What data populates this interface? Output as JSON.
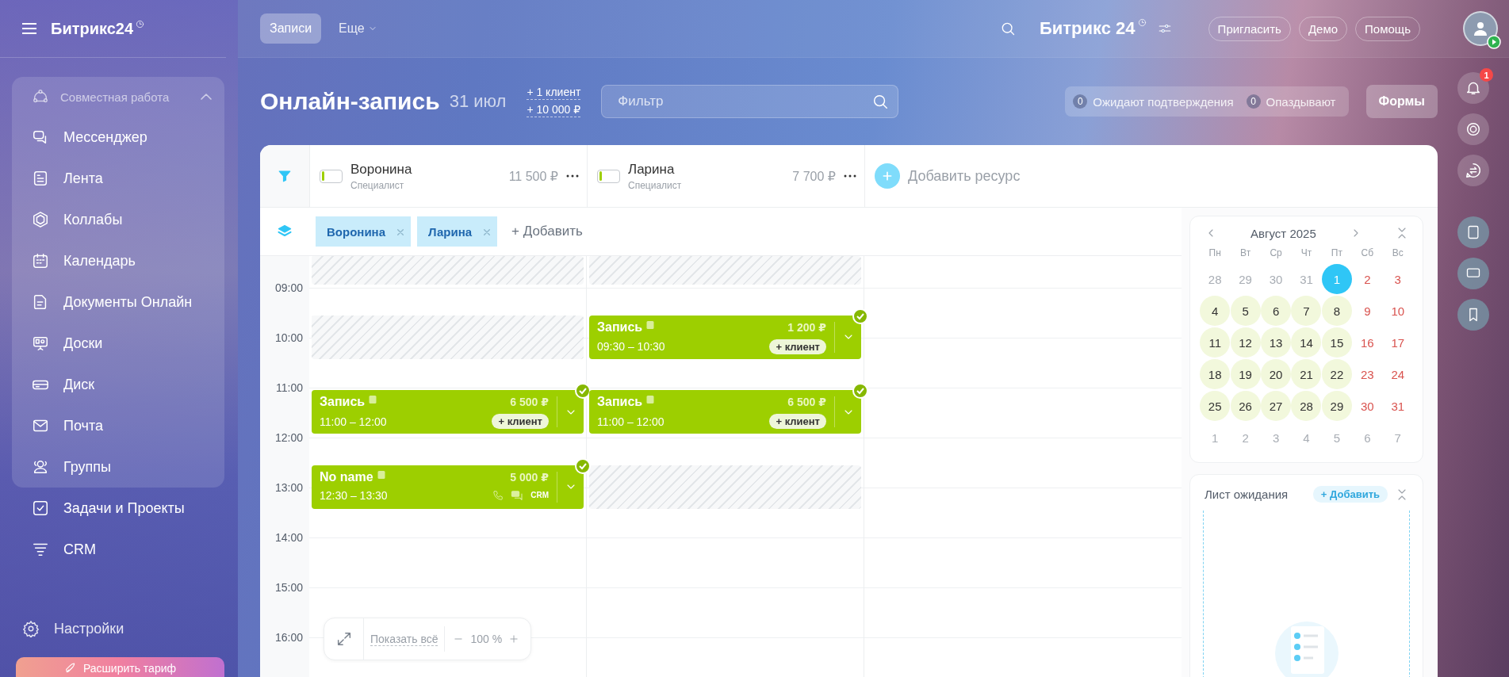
{
  "sidebar": {
    "logo": "Битрикс24",
    "group": {
      "label": "Совместная работа",
      "expanded": true,
      "items": [
        {
          "label": "Мессенджер"
        },
        {
          "label": "Лента"
        },
        {
          "label": "Коллабы"
        },
        {
          "label": "Календарь"
        },
        {
          "label": "Документы Онлайн"
        },
        {
          "label": "Доски"
        },
        {
          "label": "Диск"
        },
        {
          "label": "Почта"
        },
        {
          "label": "Группы"
        }
      ]
    },
    "items": [
      {
        "label": "Задачи и Проекты"
      },
      {
        "label": "CRM"
      }
    ],
    "settings": "Настройки",
    "upgrade": "Расширить тариф"
  },
  "topbar": {
    "tabs": [
      {
        "label": "Записи",
        "selected": true,
        "kind": "tab"
      },
      {
        "label": "Еще",
        "selected": false,
        "kind": "menu"
      }
    ],
    "logo": "Битрикс 24",
    "buttons": [
      "Пригласить",
      "Демо",
      "Помощь"
    ]
  },
  "page": {
    "title": "Онлайн-запись",
    "date": "31 июл",
    "stats": [
      "+ 1 клиент",
      "+ 10 000 ₽"
    ],
    "filter": {
      "placeholder": "Фильтр"
    },
    "counters": [
      {
        "count": "0",
        "label": "Ожидают подтверждения"
      },
      {
        "count": "0",
        "label": "Опаздывают"
      }
    ],
    "forms_button": "Формы"
  },
  "right_rail": {
    "notifications": "1"
  },
  "resources": [
    {
      "name": "Воронина",
      "role": "Специалист",
      "amount": "11 500 ₽",
      "level": 0.15
    },
    {
      "name": "Ларина",
      "role": "Специалист",
      "amount": "7 700 ₽",
      "level": 0.15
    }
  ],
  "add_resource": "Добавить ресурс",
  "tags": [
    {
      "label": "Воронина"
    },
    {
      "label": "Ларина"
    }
  ],
  "add_tag": "+ Добавить",
  "time_labels": [
    "09:00",
    "10:00",
    "11:00",
    "12:00",
    "13:00",
    "14:00",
    "15:00",
    "16:00"
  ],
  "columns": [
    {
      "slots": [
        {
          "kind": "hatch_top"
        },
        {
          "kind": "gap"
        },
        {
          "kind": "hatch"
        },
        {
          "kind": "gap"
        },
        {
          "kind": "event",
          "title": "Запись",
          "time": "11:00 – 12:00",
          "price": "6 500 ₽",
          "confirmed": true,
          "badge": {
            "kind": "client",
            "label": "+ клиент"
          }
        },
        {
          "kind": "gap"
        },
        {
          "kind": "event",
          "title": "No name",
          "time": "12:30 – 13:30",
          "price": "5 000 ₽",
          "confirmed": true,
          "badge": {
            "kind": "crm",
            "label": "CRM"
          }
        }
      ]
    },
    {
      "slots": [
        {
          "kind": "hatch_top"
        },
        {
          "kind": "gap"
        },
        {
          "kind": "event",
          "title": "Запись",
          "time": "09:30 – 10:30",
          "price": "1 200 ₽",
          "confirmed": true,
          "badge": {
            "kind": "client",
            "label": "+ клиент"
          }
        },
        {
          "kind": "gap"
        },
        {
          "kind": "event",
          "title": "Запись",
          "time": "11:00 – 12:00",
          "price": "6 500 ₽",
          "confirmed": true,
          "badge": {
            "kind": "client",
            "label": "+ клиент"
          }
        },
        {
          "kind": "gap"
        },
        {
          "kind": "hatch"
        }
      ]
    }
  ],
  "zoom": {
    "show_all": "Показать всё",
    "value": "100 %"
  },
  "mini_calendar": {
    "title": "Август 2025",
    "weekdays": [
      "Пн",
      "Вт",
      "Ср",
      "Чт",
      "Пт",
      "Сб",
      "Вс"
    ],
    "weeks": [
      [
        {
          "day": "28",
          "kind": "outside",
          "selected": false
        },
        {
          "day": "29",
          "kind": "outside",
          "selected": false
        },
        {
          "day": "30",
          "kind": "outside",
          "selected": false
        },
        {
          "day": "31",
          "kind": "outside",
          "selected": false
        },
        {
          "day": "1",
          "kind": "workday",
          "selected": true
        },
        {
          "day": "2",
          "kind": "weekend",
          "selected": false
        },
        {
          "day": "3",
          "kind": "weekend",
          "selected": false
        }
      ],
      [
        {
          "day": "4",
          "kind": "workday",
          "selected": false
        },
        {
          "day": "5",
          "kind": "workday",
          "selected": false
        },
        {
          "day": "6",
          "kind": "workday",
          "selected": false
        },
        {
          "day": "7",
          "kind": "workday",
          "selected": false
        },
        {
          "day": "8",
          "kind": "workday",
          "selected": false
        },
        {
          "day": "9",
          "kind": "weekend",
          "selected": false
        },
        {
          "day": "10",
          "kind": "weekend",
          "selected": false
        }
      ],
      [
        {
          "day": "11",
          "kind": "workday",
          "selected": false
        },
        {
          "day": "12",
          "kind": "workday",
          "selected": false
        },
        {
          "day": "13",
          "kind": "workday",
          "selected": false
        },
        {
          "day": "14",
          "kind": "workday",
          "selected": false
        },
        {
          "day": "15",
          "kind": "workday",
          "selected": false
        },
        {
          "day": "16",
          "kind": "weekend",
          "selected": false
        },
        {
          "day": "17",
          "kind": "weekend",
          "selected": false
        }
      ],
      [
        {
          "day": "18",
          "kind": "workday",
          "selected": false
        },
        {
          "day": "19",
          "kind": "workday",
          "selected": false
        },
        {
          "day": "20",
          "kind": "workday",
          "selected": false
        },
        {
          "day": "21",
          "kind": "workday",
          "selected": false
        },
        {
          "day": "22",
          "kind": "workday",
          "selected": false
        },
        {
          "day": "23",
          "kind": "weekend",
          "selected": false
        },
        {
          "day": "24",
          "kind": "weekend",
          "selected": false
        }
      ],
      [
        {
          "day": "25",
          "kind": "workday",
          "selected": false
        },
        {
          "day": "26",
          "kind": "workday",
          "selected": false
        },
        {
          "day": "27",
          "kind": "workday",
          "selected": false
        },
        {
          "day": "28",
          "kind": "workday",
          "selected": false
        },
        {
          "day": "29",
          "kind": "workday",
          "selected": false
        },
        {
          "day": "30",
          "kind": "weekend",
          "selected": false
        },
        {
          "day": "31",
          "kind": "weekend",
          "selected": false
        }
      ],
      [
        {
          "day": "1",
          "kind": "outside",
          "selected": false
        },
        {
          "day": "2",
          "kind": "outside",
          "selected": false
        },
        {
          "day": "3",
          "kind": "outside",
          "selected": false
        },
        {
          "day": "4",
          "kind": "outside",
          "selected": false
        },
        {
          "day": "5",
          "kind": "outside",
          "selected": false
        },
        {
          "day": "6",
          "kind": "outside",
          "selected": false
        },
        {
          "day": "7",
          "kind": "outside",
          "selected": false
        }
      ]
    ]
  },
  "waitlist": {
    "title": "Лист ожидания",
    "add": "+ Добавить"
  }
}
